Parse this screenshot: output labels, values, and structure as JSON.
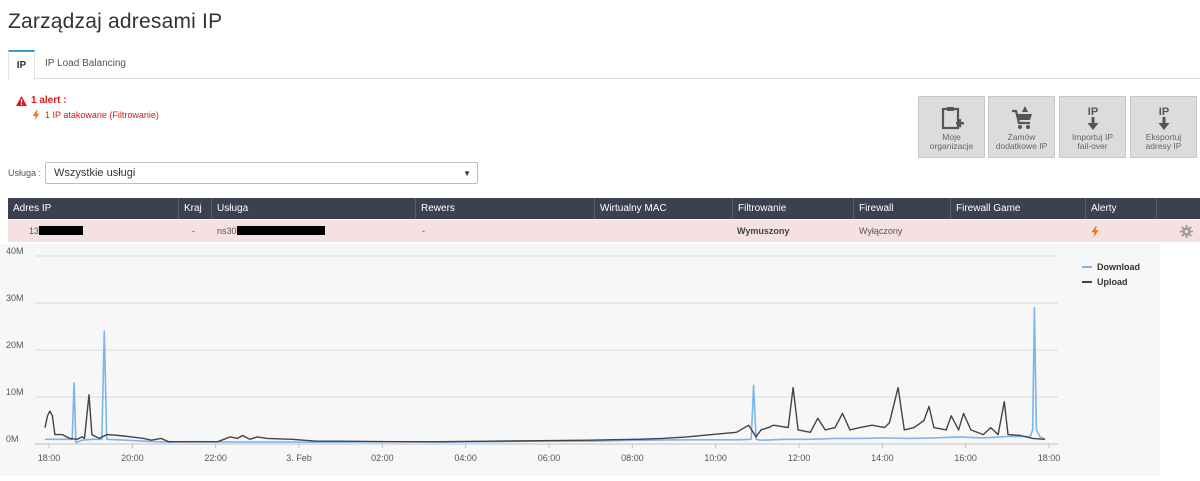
{
  "page": {
    "title": "Zarządzaj adresami IP"
  },
  "tabs": [
    {
      "label": "IP",
      "active": true
    },
    {
      "label": "IP Load Balancing",
      "active": false
    }
  ],
  "alert": {
    "title": "1 alert :",
    "message": "1 IP atakowane (Filtrowanie)",
    "icon": "warning-icon",
    "color": "#d9161c"
  },
  "actions": [
    {
      "label1": "Moje",
      "label2": "organizacje",
      "icon": "clipboard-add-icon"
    },
    {
      "label1": "Zamów",
      "label2": "dodatkowe IP",
      "icon": "cart-icon"
    },
    {
      "label1": "Importuj IP",
      "label2": "fail-over",
      "icon": "import-ip-icon"
    },
    {
      "label1": "Eksportuj",
      "label2": "adresy IP",
      "icon": "export-ip-icon"
    }
  ],
  "service_filter": {
    "label": "Usługa :",
    "selected": "Wszystkie usługi"
  },
  "table": {
    "columns": [
      "Adres IP",
      "Kraj",
      "Usługa",
      "Rewers",
      "Wirtualny MAC",
      "Filtrowanie",
      "Firewall",
      "Firewall Game",
      "Alerty"
    ],
    "row": {
      "ip_prefix": "13",
      "country": "-",
      "service_prefix": "ns30",
      "reverse": "-",
      "mac": "",
      "filtering": "Wymuszony",
      "firewall": "Wyłączony",
      "firewall_game": "",
      "alert_icon": "bolt-icon"
    }
  },
  "chart_data": {
    "type": "line",
    "ylim": [
      0,
      40
    ],
    "y_ticks": [
      "0M",
      "10M",
      "20M",
      "30M",
      "40M"
    ],
    "x_range_hours": [
      17.85,
      18.2
    ],
    "x_ticks": [
      "18:00",
      "20:00",
      "22:00",
      "3. Feb",
      "02:00",
      "04:00",
      "06:00",
      "08:00",
      "10:00",
      "12:00",
      "14:00",
      "16:00",
      "18:00"
    ],
    "legend_position": "top-right",
    "grid": true,
    "series": [
      {
        "name": "Download",
        "color": "#7cb5ec",
        "points": [
          [
            0,
            1.0
          ],
          [
            0.4,
            1.0
          ],
          [
            0.9,
            1.0
          ],
          [
            1.1,
            1.0
          ],
          [
            1.18,
            13
          ],
          [
            1.25,
            0.3
          ],
          [
            1.5,
            0.8
          ],
          [
            1.9,
            1.0
          ],
          [
            2.3,
            1.0
          ],
          [
            2.4,
            24
          ],
          [
            2.5,
            1.0
          ],
          [
            3,
            0.9
          ],
          [
            4,
            0.6
          ],
          [
            5,
            0.4
          ],
          [
            6,
            0.5
          ],
          [
            8,
            0.4
          ],
          [
            10,
            0.4
          ],
          [
            12,
            0.4
          ],
          [
            14,
            0.5
          ],
          [
            16,
            0.4
          ],
          [
            18,
            0.5
          ],
          [
            20,
            0.6
          ],
          [
            22,
            0.6
          ],
          [
            24,
            0.8
          ],
          [
            26,
            0.9
          ],
          [
            28,
            0.9
          ],
          [
            28.6,
            1.0
          ],
          [
            28.7,
            12.5
          ],
          [
            28.8,
            1.0
          ],
          [
            29,
            0.8
          ],
          [
            30,
            1.0
          ],
          [
            31,
            1.0
          ],
          [
            32,
            1.2
          ],
          [
            33,
            1.2
          ],
          [
            34,
            1.3
          ],
          [
            35,
            1.2
          ],
          [
            36,
            1.3
          ],
          [
            37,
            1.5
          ],
          [
            38,
            1.3
          ],
          [
            39,
            1.6
          ],
          [
            39.9,
            1.6
          ],
          [
            40,
            3
          ],
          [
            40.07,
            29
          ],
          [
            40.15,
            3
          ],
          [
            40.3,
            1.5
          ],
          [
            40.5,
            1.0
          ]
        ]
      },
      {
        "name": "Upload",
        "color": "#434348",
        "points": [
          [
            0,
            3.5
          ],
          [
            0.1,
            6
          ],
          [
            0.2,
            7
          ],
          [
            0.3,
            6
          ],
          [
            0.4,
            2
          ],
          [
            0.7,
            2
          ],
          [
            1.0,
            1.2
          ],
          [
            1.3,
            1.0
          ],
          [
            1.5,
            1.5
          ],
          [
            1.6,
            1.2
          ],
          [
            1.78,
            10.5
          ],
          [
            1.9,
            2
          ],
          [
            2.2,
            1.2
          ],
          [
            2.5,
            2
          ],
          [
            3,
            1.8
          ],
          [
            3.5,
            1.5
          ],
          [
            4,
            1.2
          ],
          [
            4.3,
            0.8
          ],
          [
            4.7,
            1.2
          ],
          [
            5,
            0.5
          ],
          [
            6,
            0.5
          ],
          [
            7,
            0.5
          ],
          [
            7.5,
            1.5
          ],
          [
            7.8,
            1.2
          ],
          [
            8,
            1.8
          ],
          [
            8.3,
            1.0
          ],
          [
            8.6,
            1.5
          ],
          [
            9,
            1.2
          ],
          [
            10,
            1.0
          ],
          [
            11,
            0.6
          ],
          [
            12,
            0.6
          ],
          [
            14,
            0.5
          ],
          [
            16,
            0.5
          ],
          [
            18,
            0.6
          ],
          [
            20,
            0.7
          ],
          [
            22,
            0.8
          ],
          [
            24,
            1.0
          ],
          [
            25,
            1.2
          ],
          [
            26,
            1.5
          ],
          [
            27,
            2
          ],
          [
            28,
            2.5
          ],
          [
            28.5,
            4
          ],
          [
            28.8,
            1.5
          ],
          [
            29,
            3
          ],
          [
            29.3,
            3.5
          ],
          [
            29.5,
            4
          ],
          [
            30.1,
            3.5
          ],
          [
            30.3,
            12
          ],
          [
            30.5,
            3
          ],
          [
            31,
            2.5
          ],
          [
            31.3,
            5.5
          ],
          [
            31.6,
            3
          ],
          [
            32,
            3.5
          ],
          [
            32.3,
            6.5
          ],
          [
            32.6,
            3
          ],
          [
            33,
            3.5
          ],
          [
            33.5,
            4
          ],
          [
            34,
            3.5
          ],
          [
            34.2,
            4.5
          ],
          [
            34.55,
            12
          ],
          [
            34.8,
            3
          ],
          [
            35.2,
            3.5
          ],
          [
            35.6,
            5
          ],
          [
            35.8,
            8
          ],
          [
            36,
            3.5
          ],
          [
            36.5,
            3
          ],
          [
            36.7,
            6
          ],
          [
            37,
            3
          ],
          [
            37.2,
            6.5
          ],
          [
            37.5,
            3
          ],
          [
            38,
            2
          ],
          [
            38.3,
            3.5
          ],
          [
            38.6,
            2
          ],
          [
            38.85,
            9
          ],
          [
            39,
            2
          ],
          [
            39.5,
            1.8
          ],
          [
            40,
            1.2
          ],
          [
            40.5,
            1.0
          ]
        ]
      }
    ]
  }
}
